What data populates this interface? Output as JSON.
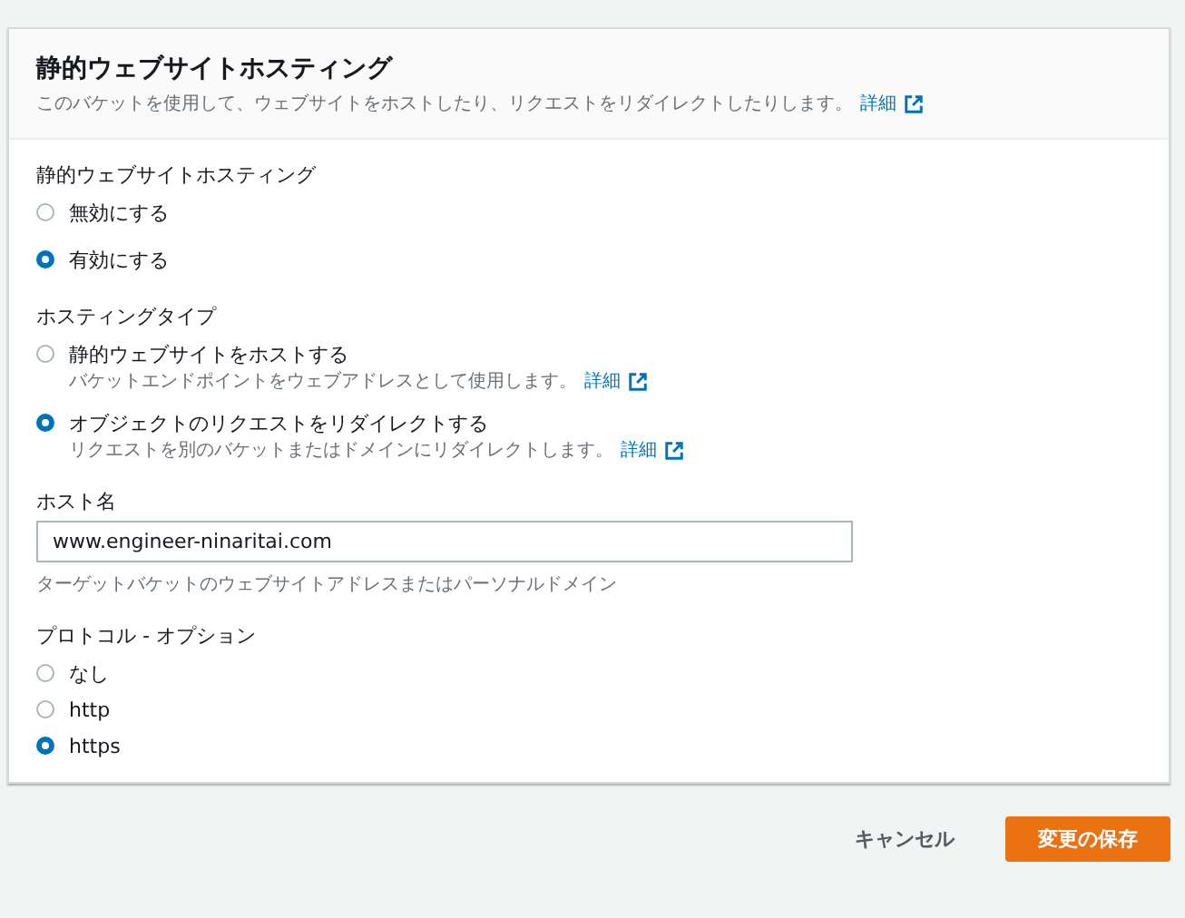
{
  "header": {
    "title": "静的ウェブサイトホスティング",
    "description": "このバケットを使用して、ウェブサイトをホストしたり、リクエストをリダイレクトしたりします。",
    "link": "詳細"
  },
  "groups": [
    {
      "label": "静的ウェブサイトホスティング",
      "options": [
        {
          "label": "無効にする",
          "selected": false
        },
        {
          "label": "有効にする",
          "selected": true
        }
      ]
    },
    {
      "label": "ホスティングタイプ",
      "options": [
        {
          "label": "静的ウェブサイトをホストする",
          "description": "バケットエンドポイントをウェブアドレスとして使用します。",
          "link": "詳細",
          "selected": false
        },
        {
          "label": "オブジェクトのリクエストをリダイレクトする",
          "description": "リクエストを別のバケットまたはドメインにリダイレクトします。",
          "link": "詳細",
          "selected": true
        }
      ]
    }
  ],
  "host_name": {
    "label": "ホスト名",
    "value": "www.engineer-ninaritai.com",
    "hint": "ターゲットバケットのウェブサイトアドレスまたはパーソナルドメイン"
  },
  "protocol": {
    "label": "プロトコル - オプション",
    "options": [
      {
        "label": "なし",
        "selected": false
      },
      {
        "label": "http",
        "selected": false
      },
      {
        "label": "https",
        "selected": true
      }
    ]
  },
  "buttons": {
    "cancel": "キャンセル",
    "save": "変更の保存"
  }
}
